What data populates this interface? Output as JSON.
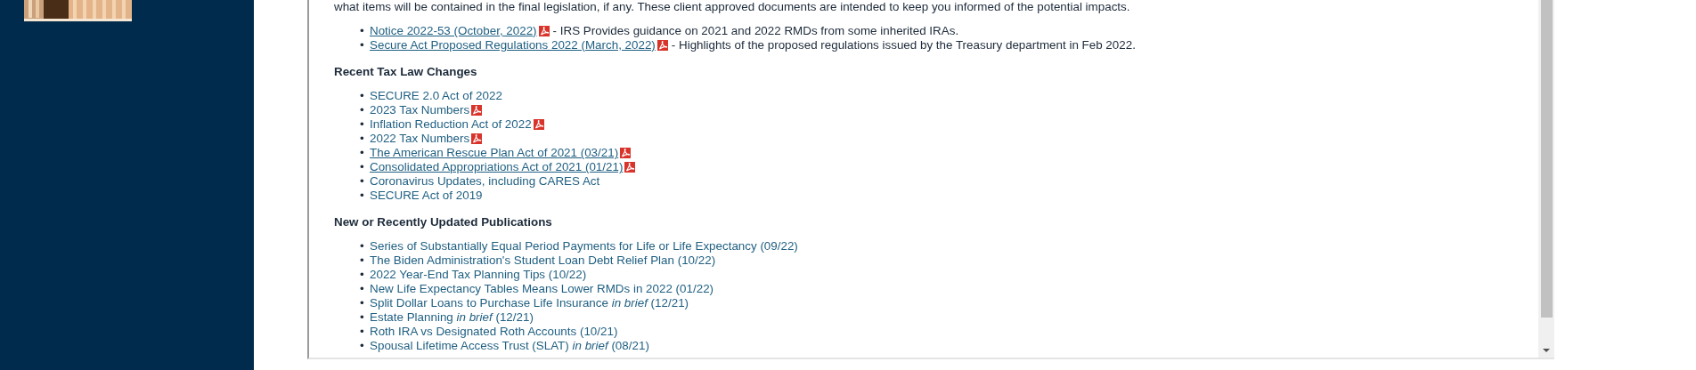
{
  "content": {
    "intro_text": "what items will be contained in the final legislation, if any.  These client approved documents are intended to keep you informed of the potential impacts.",
    "bullet": "•",
    "notices": [
      {
        "link": "Notice 2022-53 (October, 2022)",
        "underlined": true,
        "pdf": true,
        "description": "- IRS Provides guidance on 2021 and 2022 RMDs from some inherited IRAs."
      },
      {
        "link": "Secure Act Proposed Regulations 2022 (March, 2022)",
        "underlined": true,
        "pdf": true,
        "description": "- Highlights of the proposed regulations issued by the Treasury department in Feb 2022."
      }
    ],
    "sections": [
      {
        "heading": "Recent Tax Law Changes",
        "items": [
          {
            "link": "SECURE 2.0 Act of 2022",
            "underlined": false,
            "pdf": false
          },
          {
            "link": "2023 Tax Numbers",
            "underlined": false,
            "pdf": true
          },
          {
            "link": "Inflation Reduction Act of 2022",
            "underlined": false,
            "pdf": true
          },
          {
            "link": "2022 Tax Numbers",
            "underlined": false,
            "pdf": true
          },
          {
            "link": "The American Rescue Plan Act of 2021 (03/21)",
            "underlined": true,
            "pdf": true
          },
          {
            "link": "Consolidated Appropriations Act of 2021 (01/21)",
            "underlined": true,
            "pdf": true
          },
          {
            "link": "Coronavirus Updates, including CARES Act",
            "underlined": false,
            "pdf": false
          },
          {
            "link": "SECURE Act of 2019",
            "underlined": false,
            "pdf": false
          }
        ]
      },
      {
        "heading": "New or Recently Updated Publications",
        "items": [
          {
            "link": "Series of Substantially Equal Period Payments for Life or Life Expectancy (09/22)",
            "underlined": false,
            "pdf": false
          },
          {
            "link": "The Biden Administration's Student Loan Debt Relief Plan (10/22)",
            "underlined": false,
            "pdf": false
          },
          {
            "link": "2022 Year-End Tax Planning Tips (10/22)",
            "underlined": false,
            "pdf": false
          },
          {
            "link": "New Life Expectancy Tables Means Lower RMDs in 2022 (01/22)",
            "underlined": false,
            "pdf": false
          },
          {
            "link": "Split Dollar Loans to Purchase Life Insurance *in brief* (12/21)",
            "underlined": false,
            "pdf": false
          },
          {
            "link": "Estate Planning *in brief* (12/21)",
            "underlined": false,
            "pdf": false
          },
          {
            "link": "Roth IRA vs Designated Roth Accounts (10/21)",
            "underlined": false,
            "pdf": false
          },
          {
            "link": "Spousal Lifetime Access Trust (SLAT) *in brief* (08/21)",
            "underlined": false,
            "pdf": false
          }
        ]
      }
    ]
  }
}
